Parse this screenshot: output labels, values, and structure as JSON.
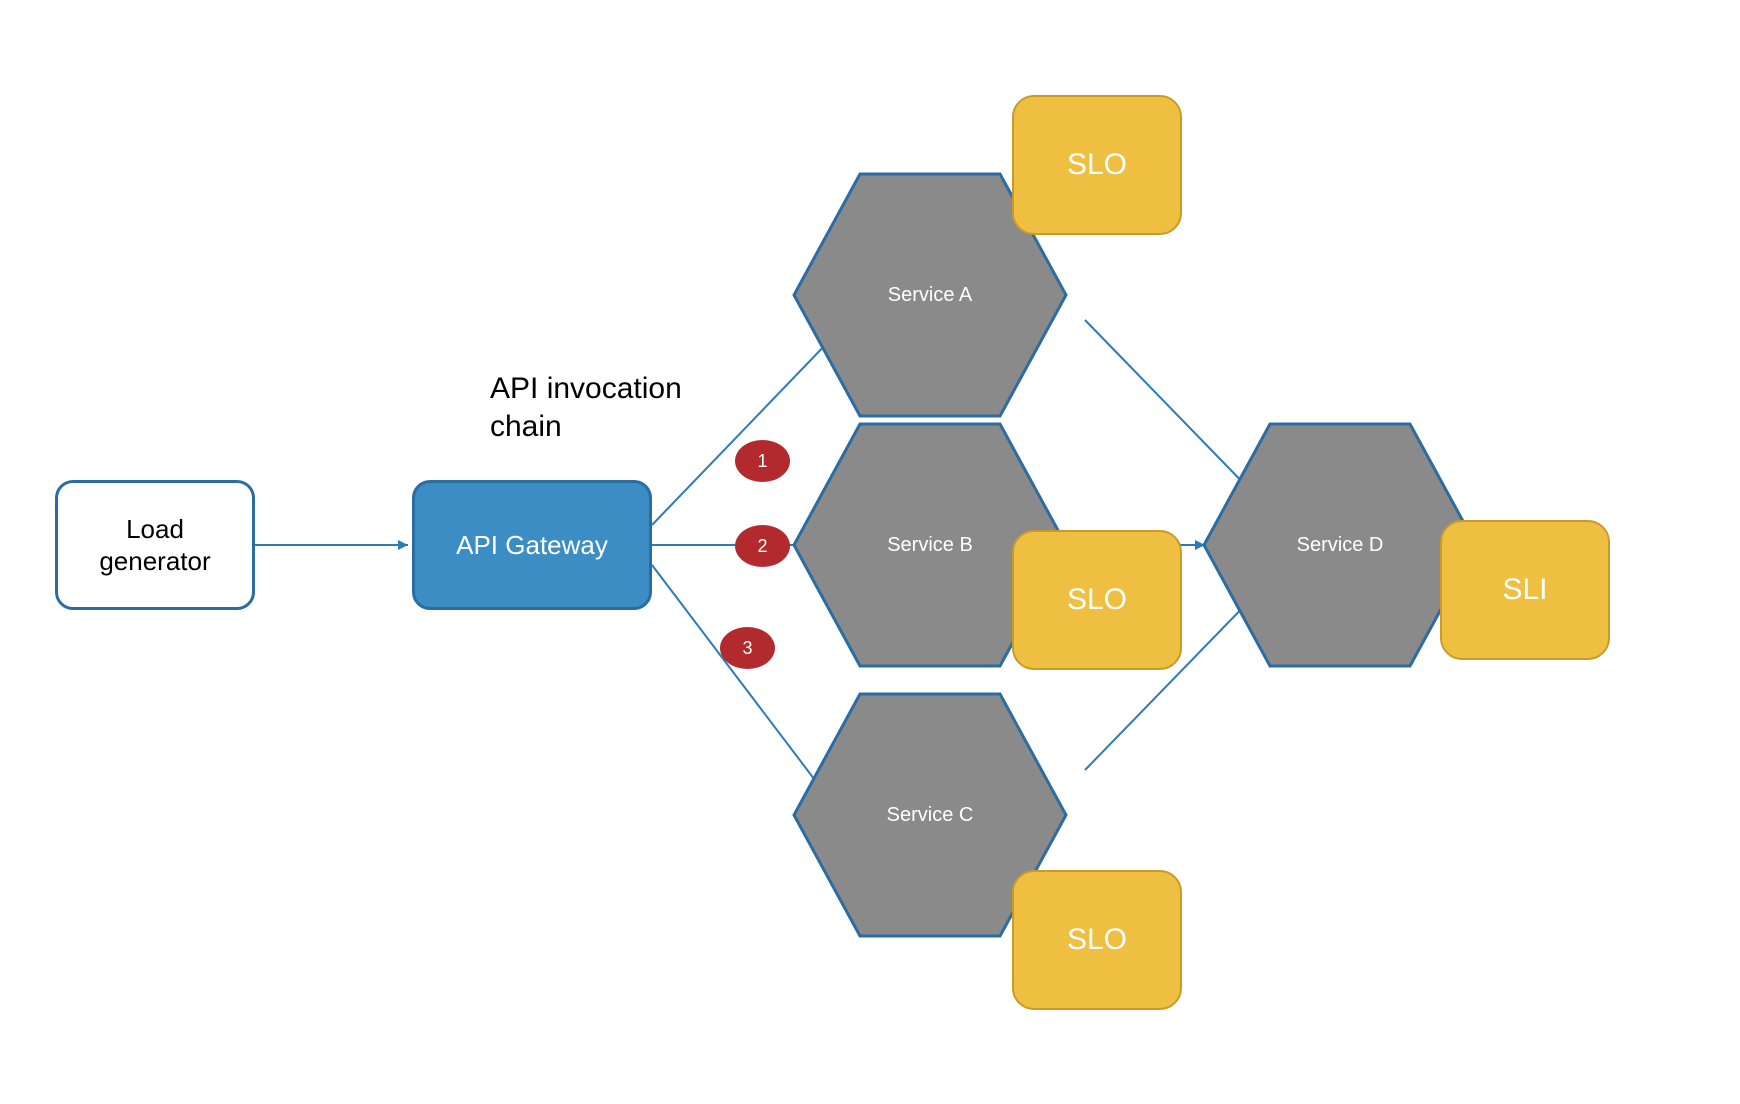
{
  "colors": {
    "blue_fill": "#3b8dc4",
    "blue_stroke": "#2b6ca3",
    "gray_fill": "#8a8a8a",
    "yellow_fill": "#efbf42",
    "yellow_stroke": "#c99a2a",
    "red_fill": "#b2292e",
    "arrow_stroke": "#2b7bb9"
  },
  "title": {
    "line1": "API invocation",
    "line2": "chain"
  },
  "load_generator": {
    "label": "Load\ngenerator"
  },
  "api_gateway": {
    "label": "API Gateway"
  },
  "services": {
    "a": {
      "label": "Service A"
    },
    "b": {
      "label": "Service B"
    },
    "c": {
      "label": "Service C"
    },
    "d": {
      "label": "Service D"
    }
  },
  "badges": {
    "slo_a": "SLO",
    "slo_b": "SLO",
    "slo_c": "SLO",
    "sli_d": "SLI"
  },
  "chain_numbers": {
    "one": "1",
    "two": "2",
    "three": "3"
  },
  "arrows": [
    {
      "name": "load-to-gateway",
      "from": "load-generator",
      "to": "api-gateway"
    },
    {
      "name": "gateway-to-a",
      "from": "api-gateway",
      "to": "service-a",
      "number": "1"
    },
    {
      "name": "gateway-to-b",
      "from": "api-gateway",
      "to": "service-b",
      "number": "2"
    },
    {
      "name": "gateway-to-c",
      "from": "api-gateway",
      "to": "service-c",
      "number": "3"
    },
    {
      "name": "a-to-d",
      "from": "service-a",
      "to": "service-d"
    },
    {
      "name": "b-to-d",
      "from": "service-b",
      "to": "service-d"
    },
    {
      "name": "c-to-d",
      "from": "service-c",
      "to": "service-d"
    }
  ]
}
